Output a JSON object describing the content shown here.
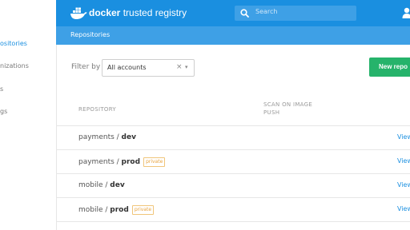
{
  "sidebar": {
    "items": [
      {
        "label": "ositories",
        "active": true
      },
      {
        "label": "nizations",
        "active": false
      },
      {
        "label": "s",
        "active": false
      },
      {
        "label": "gs",
        "active": false
      }
    ]
  },
  "header": {
    "brand_prefix": "docker",
    "brand_suffix": "trusted registry",
    "search_placeholder": "Search",
    "accent_color": "#1a8fe0"
  },
  "breadcrumb": {
    "label": "Repositories"
  },
  "filter": {
    "label": "Filter by",
    "selected": "All accounts",
    "clear_icon": "×",
    "caret_icon": "▾"
  },
  "actions": {
    "new_repo_label": "New repo"
  },
  "table": {
    "columns": [
      "REPOSITORY",
      "SCAN ON IMAGE PUSH"
    ],
    "rows": [
      {
        "namespace": "payments",
        "name": "dev",
        "badge": "",
        "action": "View"
      },
      {
        "namespace": "payments",
        "name": "prod",
        "badge": "private",
        "action": "View"
      },
      {
        "namespace": "mobile",
        "name": "dev",
        "badge": "",
        "action": "View"
      },
      {
        "namespace": "mobile",
        "name": "prod",
        "badge": "private",
        "action": "View"
      }
    ]
  }
}
